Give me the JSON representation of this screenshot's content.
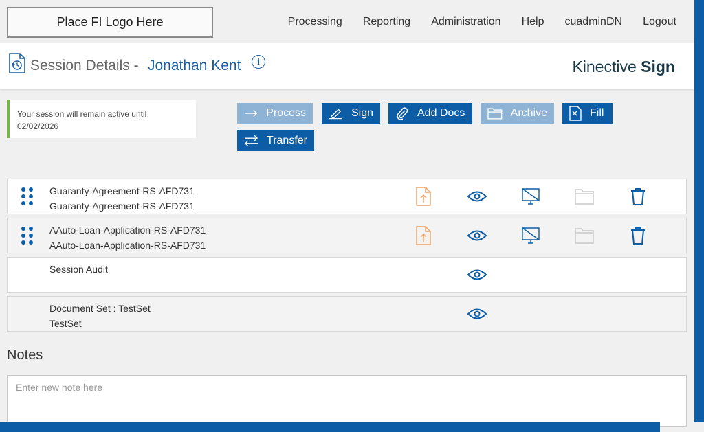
{
  "logo": {
    "text": "Place FI Logo Here"
  },
  "nav": {
    "items": [
      "Processing",
      "Reporting",
      "Administration",
      "Help",
      "cuadminDN",
      "Logout"
    ]
  },
  "header": {
    "title": "Session Details -",
    "name": "Jonathan Kent",
    "info_icon": "i",
    "brand_light": "Kinective",
    "brand_bold": "Sign"
  },
  "session_notice": {
    "line1": "Your session will remain active until",
    "line2": "02/02/2026"
  },
  "actions": {
    "process": "Process",
    "sign": "Sign",
    "add_docs": "Add Docs",
    "archive": "Archive",
    "fill": "Fill",
    "transfer": "Transfer"
  },
  "documents": [
    {
      "line1": "Guaranty-Agreement-RS-AFD731",
      "line2": "Guaranty-Agreement-RS-AFD731"
    },
    {
      "line1": "AAuto-Loan-Application-RS-AFD731",
      "line2": "AAuto-Loan-Application-RS-AFD731"
    },
    {
      "line1": "Session Audit",
      "line2": ""
    },
    {
      "line1": "Document Set : TestSet",
      "line2": "TestSet"
    }
  ],
  "notes": {
    "title": "Notes",
    "placeholder": "Enter new note here"
  },
  "colors": {
    "primary": "#0d5da6",
    "primary_disabled": "#8fb3d4",
    "upload_orange": "#f0a060",
    "notice_green": "#7ab648"
  }
}
